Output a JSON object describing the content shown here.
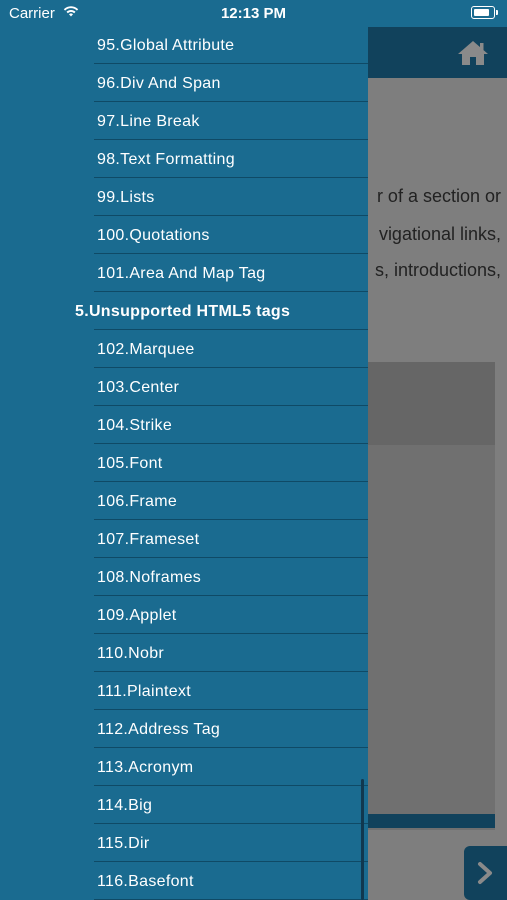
{
  "status_bar": {
    "carrier": "Carrier",
    "time": "12:13 PM"
  },
  "background": {
    "lines": [
      "r of a section or",
      "vigational links,",
      "s,  introductions,"
    ]
  },
  "drawer": {
    "items": [
      {
        "label": "95.Global Attribute",
        "section": false
      },
      {
        "label": "96.Div And Span",
        "section": false
      },
      {
        "label": "97.Line Break",
        "section": false
      },
      {
        "label": "98.Text Formatting",
        "section": false
      },
      {
        "label": "99.Lists",
        "section": false
      },
      {
        "label": "100.Quotations",
        "section": false
      },
      {
        "label": "101.Area And Map Tag",
        "section": false
      },
      {
        "label": "5.Unsupported HTML5 tags",
        "section": true
      },
      {
        "label": "102.Marquee",
        "section": false
      },
      {
        "label": "103.Center",
        "section": false
      },
      {
        "label": "104.Strike",
        "section": false
      },
      {
        "label": "105.Font",
        "section": false
      },
      {
        "label": "106.Frame",
        "section": false
      },
      {
        "label": "107.Frameset",
        "section": false
      },
      {
        "label": "108.Noframes",
        "section": false
      },
      {
        "label": "109.Applet",
        "section": false
      },
      {
        "label": "110.Nobr",
        "section": false
      },
      {
        "label": "111.Plaintext",
        "section": false
      },
      {
        "label": "112.Address Tag",
        "section": false
      },
      {
        "label": "113.Acronym",
        "section": false
      },
      {
        "label": "114.Big",
        "section": false
      },
      {
        "label": "115.Dir",
        "section": false
      },
      {
        "label": "116.Basefont",
        "section": false
      }
    ]
  },
  "colors": {
    "drawer_bg": "#1a6b90",
    "header_bg": "#11425c",
    "separator": "#0f4a66"
  },
  "icons": {
    "home": "home-icon",
    "wifi": "wifi-icon",
    "battery": "battery-icon",
    "next": "chevron-right-icon"
  }
}
